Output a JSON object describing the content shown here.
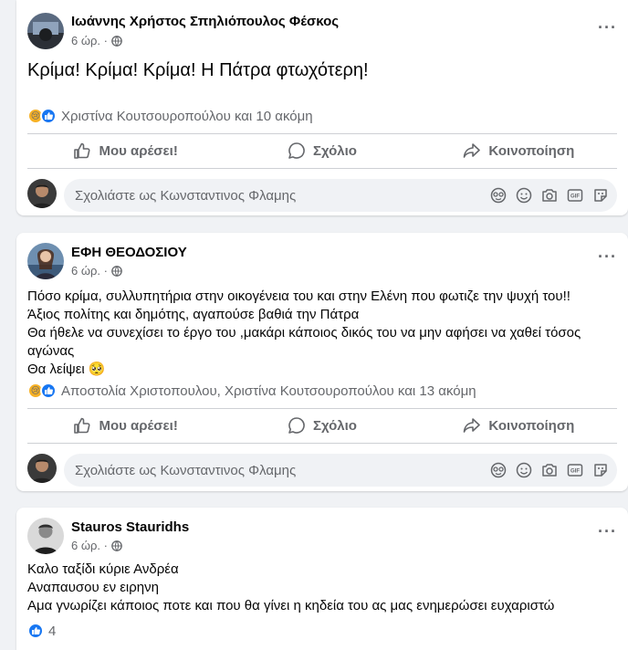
{
  "posts": [
    {
      "author": "Ιωάννης Χρήστος Σπηλιόπουλος Φέσκος",
      "time": "6 ώρ. ·",
      "text_lines": [
        "Κρίμα! Κρίμα! Κρίμα! Η Πάτρα φτωχότερη!"
      ],
      "reactions_text": "Χριστίνα Κουτσουροπούλου και 10 ακόμη",
      "actions": {
        "like": "Μου αρέσει!",
        "comment": "Σχόλιο",
        "share": "Κοινοποίηση"
      },
      "comment_placeholder": "Σχολιάστε ως Κωνσταντινος Φλαμης"
    },
    {
      "author": "ΕΦΗ ΘΕΟΔΟΣΙΟΥ",
      "time": "6 ώρ. ·",
      "text_lines": [
        "Πόσο κρίμα, συλλυπητήρια στην οικογένεια του και στην Ελένη που φωτιζε την ψυχή του!!",
        "Άξιος πολίτης και δημότης, αγαπούσε βαθιά την Πάτρα",
        "Θα ήθελε να συνεχίσει το έργο του ,μακάρι κάποιος δικός του να μην αφήσει να χαθεί τόσος",
        "αγώνας",
        "Θα λείψει 🥺"
      ],
      "reactions_text": "Αποστολία Χριστοπουλου, Χριστίνα Κουτσουροπούλου και 13 ακόμη",
      "actions": {
        "like": "Μου αρέσει!",
        "comment": "Σχόλιο",
        "share": "Κοινοποίηση"
      },
      "comment_placeholder": "Σχολιάστε ως Κωνσταντινος Φλαμης"
    },
    {
      "author": "Stauros Stauridhs",
      "time": "6 ώρ. ·",
      "text_lines": [
        "Καλο ταξίδι κύριε Ανδρέα",
        "Αναπαυσου εν ειρηνη",
        "Αμα γνωρίζει κάποιος ποτε και που θα γίνει η κηδεία του ας μας ενημερώσει ευχαριστώ"
      ],
      "reactions_count": "4"
    }
  ],
  "colors": {
    "background": "#f0f2f5",
    "card": "#ffffff",
    "secondary_text": "#65676b",
    "like_blue": "#1877f2",
    "sad_yellow": "#f7b125"
  }
}
